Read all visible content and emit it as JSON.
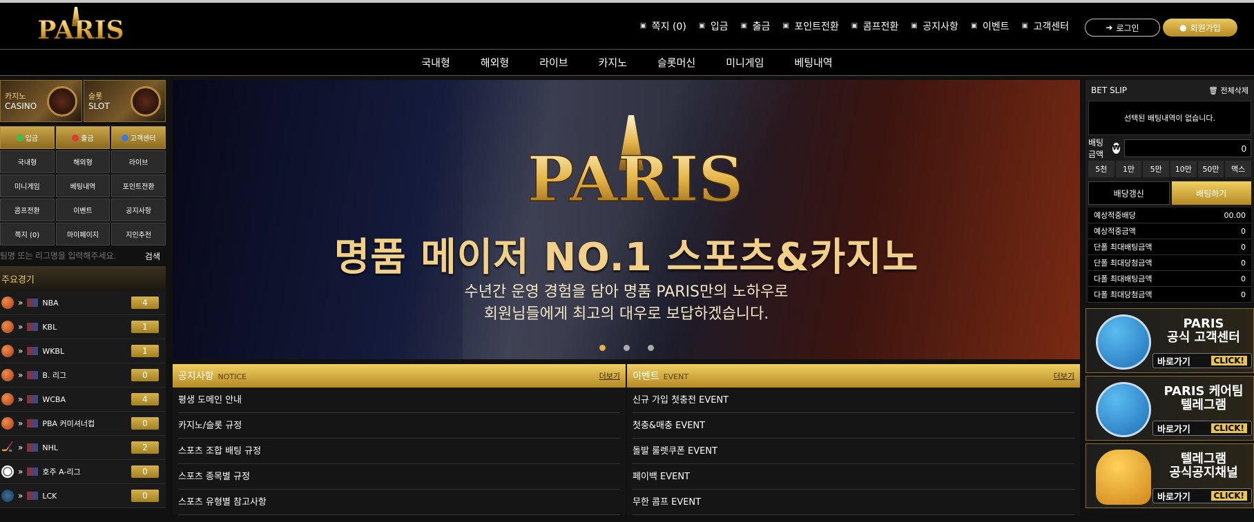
{
  "header": {
    "logo_text": "PARIS",
    "nav": [
      {
        "label": "쪽지 (0)",
        "icon": "mail-icon"
      },
      {
        "label": "입금",
        "icon": "deposit-icon"
      },
      {
        "label": "출금",
        "icon": "withdraw-icon"
      },
      {
        "label": "포인트전환",
        "icon": "point-icon"
      },
      {
        "label": "콤프전환",
        "icon": "comp-icon"
      },
      {
        "label": "공지사항",
        "icon": "bell-icon"
      },
      {
        "label": "이벤트",
        "icon": "gift-icon"
      },
      {
        "label": "고객센터",
        "icon": "headset-icon"
      }
    ],
    "login_label": "로그인",
    "join_label": "회원가입"
  },
  "main_nav": [
    "국내형",
    "해외형",
    "라이브",
    "카지노",
    "슬롯머신",
    "미니게임",
    "베팅내역"
  ],
  "left": {
    "promos": [
      {
        "ko": "카지노",
        "en": "CASINO"
      },
      {
        "ko": "슬롯",
        "en": "SLOT"
      }
    ],
    "grid": [
      {
        "label": "입금",
        "gold": true,
        "dot": "#3fbf4a"
      },
      {
        "label": "출금",
        "gold": true,
        "dot": "#e03a3a"
      },
      {
        "label": "고객센터",
        "gold": true,
        "dot": "#3a7ae0"
      },
      {
        "label": "국내형"
      },
      {
        "label": "해외형"
      },
      {
        "label": "라이브"
      },
      {
        "label": "미니게임"
      },
      {
        "label": "베팅내역"
      },
      {
        "label": "포인트전환"
      },
      {
        "label": "콤프전환"
      },
      {
        "label": "이벤트"
      },
      {
        "label": "공지사항"
      },
      {
        "label": "쪽지 (0)"
      },
      {
        "label": "마이페이지"
      },
      {
        "label": "지인추천"
      }
    ],
    "search_placeholder": "팀명 또는 리그명을 입력해주세요.",
    "search_label": "검색",
    "major_title": "주요경기",
    "leagues": [
      {
        "name": "NBA",
        "count": "4",
        "sport": "basketball"
      },
      {
        "name": "KBL",
        "count": "1",
        "sport": "basketball"
      },
      {
        "name": "WKBL",
        "count": "1",
        "sport": "basketball"
      },
      {
        "name": "B. 리그",
        "count": "0",
        "sport": "basketball"
      },
      {
        "name": "WCBA",
        "count": "4",
        "sport": "basketball"
      },
      {
        "name": "PBA 커미셔너컵",
        "count": "0",
        "sport": "basketball"
      },
      {
        "name": "NHL",
        "count": "2",
        "sport": "hockey"
      },
      {
        "name": "호주 A-리그",
        "count": "0",
        "sport": "soccer"
      },
      {
        "name": "LCK",
        "count": "0",
        "sport": "lol"
      }
    ]
  },
  "banner": {
    "logo_text": "PARIS",
    "headline": "명품 메이저 NO.1 스포츠&카지노",
    "sub1": "수년간 운영 경험을 담아 명품 PARIS만의 노하우로",
    "sub2": "회원님들에게 최고의 대우로 보답하겠습니다."
  },
  "notice": {
    "title": "공지사항",
    "title_en": "NOTICE",
    "more": "더보기",
    "rows": [
      "평생 도메인 안내",
      "카지노/슬롯 규정",
      "스포츠 조합 배팅 규정",
      "스포츠 종목별 규정",
      "스포츠 유형별 참고사항"
    ]
  },
  "event": {
    "title": "이벤트",
    "title_en": "EVENT",
    "more": "더보기",
    "rows": [
      "신규 가입 첫충전 EVENT",
      "첫충&매충 EVENT",
      "돌발 룰렛쿠폰 EVENT",
      "페이백 EVENT",
      "무한 콤프 EVENT"
    ]
  },
  "slip": {
    "title": "BET SLIP",
    "clear": "전체삭제",
    "empty": "선택된 배팅내역이 없습니다.",
    "amount_label": "배팅금액",
    "won": "₩",
    "amount_value": "0",
    "chips": [
      "5천",
      "1만",
      "5만",
      "10만",
      "50만",
      "맥스"
    ],
    "refresh": "배당갱신",
    "bet": "배팅하기",
    "kv": [
      {
        "k": "예상적중배당",
        "v": "00.00"
      },
      {
        "k": "예상적중금액",
        "v": "0"
      },
      {
        "k": "단폴 최대배팅금액",
        "v": "0"
      },
      {
        "k": "단폴 최대당첨금액",
        "v": "0"
      },
      {
        "k": "다폴 최대배팅금액",
        "v": "0"
      },
      {
        "k": "다폴 최대당첨금액",
        "v": "0"
      }
    ]
  },
  "telegram": [
    {
      "line1": "PARIS",
      "line2": "공식 고객센터",
      "go": "바로가기",
      "click": "CLICK!",
      "art": "plane"
    },
    {
      "line1": "PARIS 케어팀",
      "line2": "텔레그램",
      "go": "바로가기",
      "click": "CLICK!",
      "art": "plane"
    },
    {
      "line1": "텔레그램",
      "line2": "공식공지채널",
      "go": "바로가기",
      "click": "CLICK!",
      "art": "bell"
    }
  ]
}
